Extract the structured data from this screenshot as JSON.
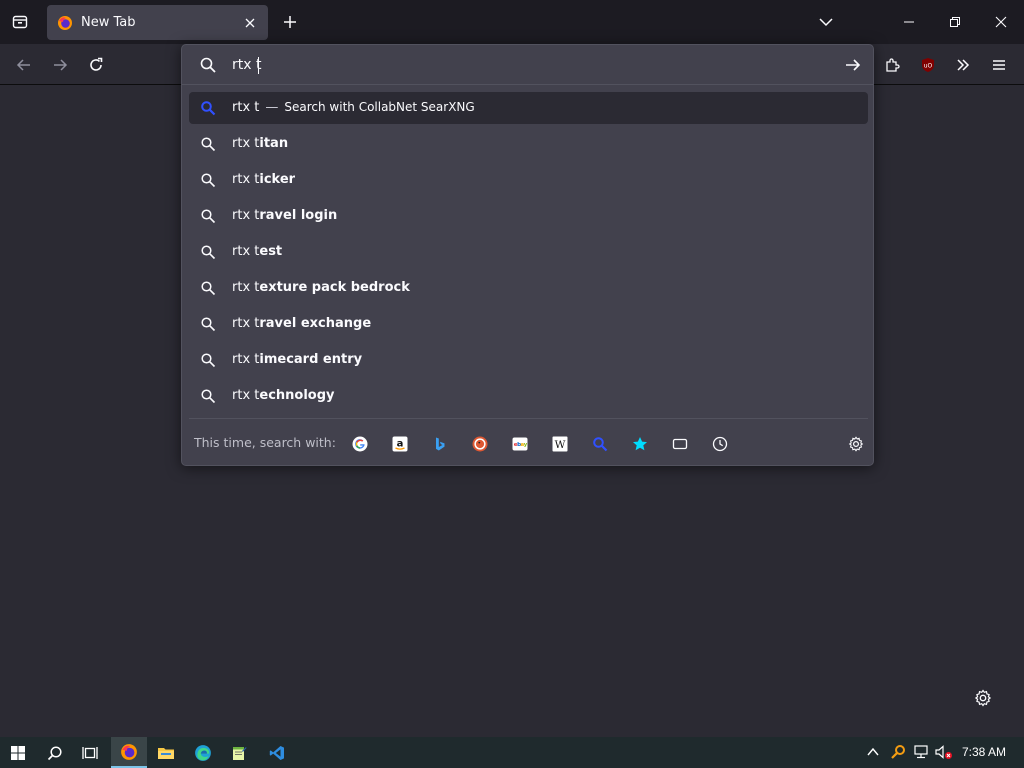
{
  "tab": {
    "title": "New Tab"
  },
  "urlbar": {
    "value": "rtx t",
    "placeholder": ""
  },
  "results": [
    {
      "typed": "rtx t",
      "suffix": "",
      "dash": "—",
      "action": "Search with CollabNet SearXNG",
      "selected": true
    },
    {
      "typed": "rtx t",
      "suffix": "itan"
    },
    {
      "typed": "rtx t",
      "suffix": "icker"
    },
    {
      "typed": "rtx t",
      "suffix": "ravel login"
    },
    {
      "typed": "rtx t",
      "suffix": "est"
    },
    {
      "typed": "rtx t",
      "suffix": "exture pack bedrock"
    },
    {
      "typed": "rtx t",
      "suffix": "ravel exchange"
    },
    {
      "typed": "rtx t",
      "suffix": "imecard entry"
    },
    {
      "typed": "rtx t",
      "suffix": "echnology"
    }
  ],
  "oneoff": {
    "label": "This time, search with:",
    "engines": [
      "google-icon",
      "amazon-icon",
      "bing-icon",
      "duckduckgo-icon",
      "ebay-icon",
      "wikipedia-icon",
      "searxng-icon",
      "bookmarks-icon",
      "tabs-icon",
      "history-icon"
    ]
  },
  "taskbar": {
    "clock": "7:38 AM"
  },
  "colors": {
    "accent": "#7cc4e8",
    "searxng": "#3050ff",
    "ublock": "#800000"
  }
}
